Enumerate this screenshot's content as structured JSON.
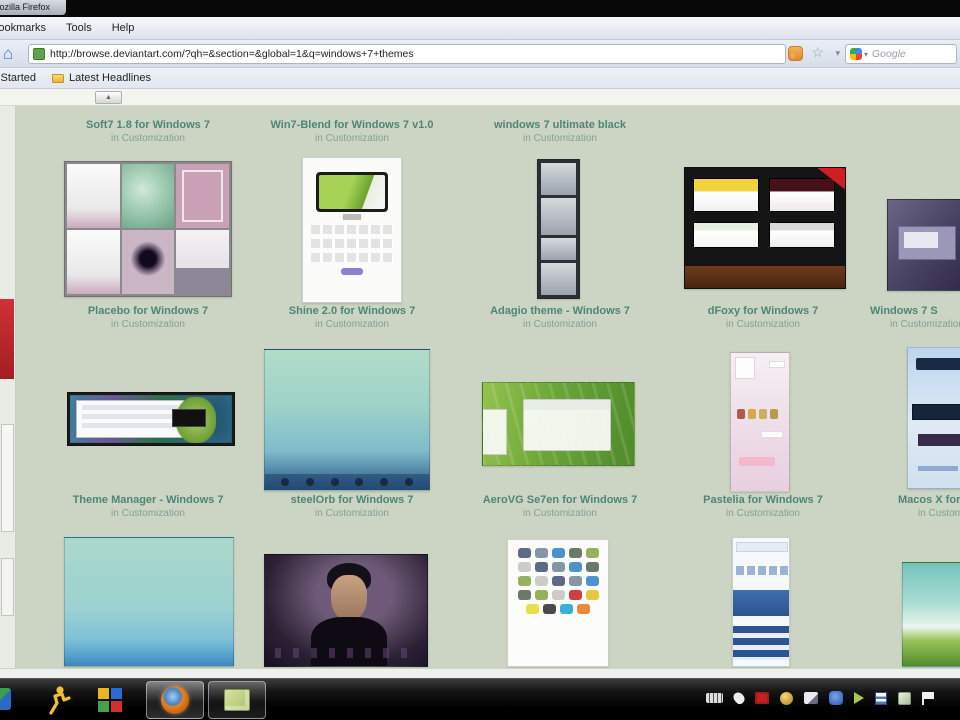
{
  "window": {
    "title": "Mozilla Firefox"
  },
  "menubar": {
    "items": [
      {
        "label": "Bookmarks"
      },
      {
        "label": "Tools"
      },
      {
        "label": "Help"
      }
    ]
  },
  "navbar": {
    "url": "http://browse.deviantart.com/?qh=&section=&global=1&q=windows+7+themes",
    "search_placeholder": "Google"
  },
  "bookmarks_bar": {
    "items": [
      {
        "label": "Getting Started"
      },
      {
        "label": "Latest Headlines"
      }
    ]
  },
  "page": {
    "results": {
      "row1": [
        {
          "title": "Soft7 1.8 for Windows 7",
          "category": "in Customization"
        },
        {
          "title": "Win7-Blend for Windows 7 v1.0",
          "category": "in Customization"
        },
        {
          "title": "windows 7 ultimate black",
          "category": "in Customization"
        }
      ],
      "row2": [
        {
          "title": "Placebo for Windows 7",
          "category": "in Customization"
        },
        {
          "title": "Shine 2.0 for Windows 7",
          "category": "in Customization"
        },
        {
          "title": "Adagio theme - Windows 7",
          "category": "in Customization"
        },
        {
          "title": "dFoxy for Windows 7",
          "category": "in Customization"
        },
        {
          "title": "Windows 7 S",
          "category": "in Customization"
        }
      ],
      "row3": [
        {
          "title": "Theme Manager - Windows 7",
          "category": "in Customization"
        },
        {
          "title": "steelOrb for Windows 7",
          "category": "in Customization"
        },
        {
          "title": "AeroVG Se7en for Windows 7",
          "category": "in Customization"
        },
        {
          "title": "Pastelia for Windows 7",
          "category": "in Customization"
        },
        {
          "title": "Macos X for W",
          "category": "in Customization"
        }
      ]
    }
  },
  "colors": {
    "page_bg": "#ccd5c3",
    "link": "#4d8577",
    "rail_red": "#c4292e"
  },
  "taskbar": {
    "apps": [
      "aim",
      "four-color-logo",
      "firefox",
      "notes"
    ],
    "tray_icons": [
      "grill",
      "droplet",
      "red-badge",
      "gold-badge",
      "photo",
      "blue-app",
      "play-arrow",
      "document",
      "leaf-app",
      "flag"
    ]
  }
}
